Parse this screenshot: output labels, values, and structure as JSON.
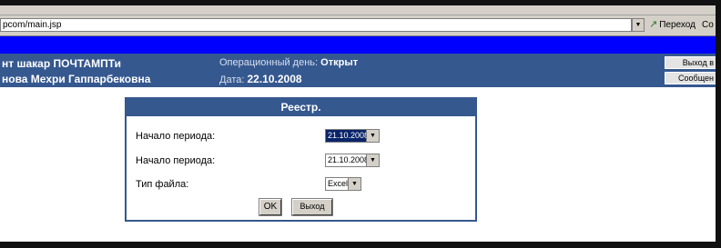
{
  "browser": {
    "address": "pcom/main.jsp",
    "go_label": "Переход",
    "go_extra": "Co"
  },
  "header": {
    "org_name": "нт шакар ПОЧТАМПТи",
    "user_name": "нова Мехри Гаппарбековна",
    "opday_label": "Операционный день:",
    "opday_status": "Открыт",
    "date_label": "Дата:",
    "date_value": "22.10.2008",
    "exit_button": "Выход в",
    "messages_button": "Сообщен"
  },
  "dialog": {
    "title": "Реестр.",
    "fields": [
      {
        "label": "Начало периода:",
        "value": "21.10.2008",
        "selected": true
      },
      {
        "label": "Начало периода:",
        "value": "21.10.2008",
        "selected": false
      },
      {
        "label": "Тип файла:",
        "value": "Excel",
        "selected": false
      }
    ],
    "ok_button": "OK",
    "exit_button": "Выход"
  },
  "icons": {
    "dropdown": "chevron-down-icon",
    "go": "go-arrow-icon"
  },
  "colors": {
    "header_bg": "#35588f",
    "blue_stripe": "#0000ff",
    "selection": "#0a246a"
  }
}
